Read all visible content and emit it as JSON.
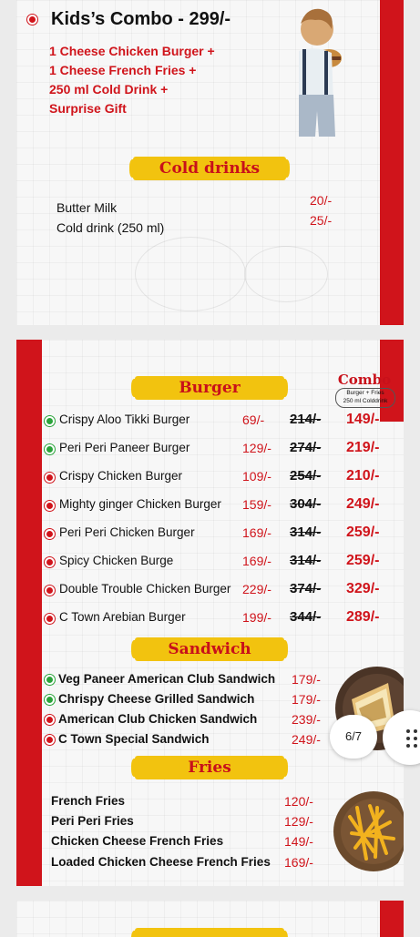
{
  "kids_combo": {
    "title": "Kids’s Combo - 299/-",
    "lines": [
      "1 Cheese Chicken Burger +",
      "1 Cheese French Fries +",
      "250 ml Cold Drink +",
      "Surprise Gift"
    ]
  },
  "cold_drinks": {
    "heading": "Cold drinks",
    "items": [
      {
        "name": "Butter Milk",
        "price": "20/-"
      },
      {
        "name": "Cold drink (250 ml)",
        "price": "25/-"
      }
    ]
  },
  "burger": {
    "heading": "Burger",
    "combo_label": "Combo",
    "combo_sub_1": "Burger + Fries",
    "combo_sub_2": "250 ml Colddrink",
    "items": [
      {
        "name": "Crispy Aloo Tikki Burger",
        "veg": true,
        "price": "69/-",
        "old": "214/-",
        "combo": "149/-"
      },
      {
        "name": "Peri Peri Paneer Burger",
        "veg": true,
        "price": "129/-",
        "old": "274/-",
        "combo": "219/-"
      },
      {
        "name": "Crispy Chicken Burger",
        "veg": false,
        "price": "109/-",
        "old": "254/-",
        "combo": "210/-"
      },
      {
        "name": "Mighty ginger Chicken Burger",
        "veg": false,
        "price": "159/-",
        "old": "304/-",
        "combo": "249/-"
      },
      {
        "name": "Peri Peri Chicken Burger",
        "veg": false,
        "price": "169/-",
        "old": "314/-",
        "combo": "259/-"
      },
      {
        "name": "Spicy Chicken Burge",
        "veg": false,
        "price": "169/-",
        "old": "314/-",
        "combo": "259/-"
      },
      {
        "name": "Double Trouble Chicken Burger",
        "veg": false,
        "price": "229/-",
        "old": "374/-",
        "combo": "329/-"
      },
      {
        "name": "C Town Arebian Burger",
        "veg": false,
        "price": "199/-",
        "old": "344/-",
        "combo": "289/-"
      }
    ]
  },
  "sandwich": {
    "heading": "Sandwich",
    "items": [
      {
        "name": "Veg Paneer American Club Sandwich",
        "veg": true,
        "price": "179/-"
      },
      {
        "name": "Chrispy Cheese Grilled Sandwich",
        "veg": true,
        "price": "179/-"
      },
      {
        "name": "American Club Chicken Sandwich",
        "veg": false,
        "price": "239/-"
      },
      {
        "name": "C Town Special Sandwich",
        "veg": false,
        "price": "249/-"
      }
    ]
  },
  "fries": {
    "heading": "Fries",
    "items": [
      {
        "name": "French Fries",
        "price": "120/-"
      },
      {
        "name": "Peri Peri Fries",
        "price": "129/-"
      },
      {
        "name": "Chicken Cheese French Fries",
        "price": "149/-"
      },
      {
        "name": "Loaded Chicken Cheese French Fries",
        "price": "169/-"
      }
    ]
  },
  "pager": {
    "label": "6/7"
  },
  "colors": {
    "accent_red": "#d0141b",
    "banner_yellow": "#f2c30f",
    "veg_green": "#2aa33a"
  }
}
